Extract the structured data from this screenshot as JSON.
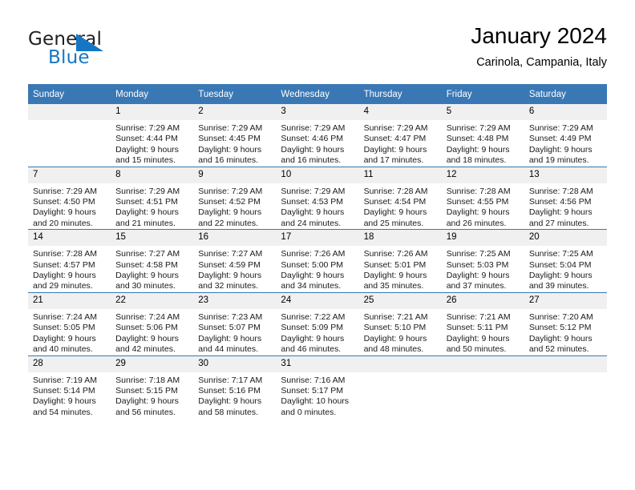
{
  "brand": {
    "name_part1": "General",
    "name_part2": "Blue",
    "logo_icon": "triangle-flag-icon"
  },
  "header": {
    "title": "January 2024",
    "subtitle": "Carinola, Campania, Italy"
  },
  "colors": {
    "header_blue": "#3a78b5",
    "daynum_band": "#f0f0f0",
    "brand_blue": "#1577c4"
  },
  "weekdays": [
    "Sunday",
    "Monday",
    "Tuesday",
    "Wednesday",
    "Thursday",
    "Friday",
    "Saturday"
  ],
  "weeks": [
    [
      {
        "day": "",
        "blank": true,
        "sunrise": "",
        "sunset": "",
        "daylight1": "",
        "daylight2": ""
      },
      {
        "day": "1",
        "sunrise": "Sunrise: 7:29 AM",
        "sunset": "Sunset: 4:44 PM",
        "daylight1": "Daylight: 9 hours",
        "daylight2": "and 15 minutes."
      },
      {
        "day": "2",
        "sunrise": "Sunrise: 7:29 AM",
        "sunset": "Sunset: 4:45 PM",
        "daylight1": "Daylight: 9 hours",
        "daylight2": "and 16 minutes."
      },
      {
        "day": "3",
        "sunrise": "Sunrise: 7:29 AM",
        "sunset": "Sunset: 4:46 PM",
        "daylight1": "Daylight: 9 hours",
        "daylight2": "and 16 minutes."
      },
      {
        "day": "4",
        "sunrise": "Sunrise: 7:29 AM",
        "sunset": "Sunset: 4:47 PM",
        "daylight1": "Daylight: 9 hours",
        "daylight2": "and 17 minutes."
      },
      {
        "day": "5",
        "sunrise": "Sunrise: 7:29 AM",
        "sunset": "Sunset: 4:48 PM",
        "daylight1": "Daylight: 9 hours",
        "daylight2": "and 18 minutes."
      },
      {
        "day": "6",
        "sunrise": "Sunrise: 7:29 AM",
        "sunset": "Sunset: 4:49 PM",
        "daylight1": "Daylight: 9 hours",
        "daylight2": "and 19 minutes."
      }
    ],
    [
      {
        "day": "7",
        "sunrise": "Sunrise: 7:29 AM",
        "sunset": "Sunset: 4:50 PM",
        "daylight1": "Daylight: 9 hours",
        "daylight2": "and 20 minutes."
      },
      {
        "day": "8",
        "sunrise": "Sunrise: 7:29 AM",
        "sunset": "Sunset: 4:51 PM",
        "daylight1": "Daylight: 9 hours",
        "daylight2": "and 21 minutes."
      },
      {
        "day": "9",
        "sunrise": "Sunrise: 7:29 AM",
        "sunset": "Sunset: 4:52 PM",
        "daylight1": "Daylight: 9 hours",
        "daylight2": "and 22 minutes."
      },
      {
        "day": "10",
        "sunrise": "Sunrise: 7:29 AM",
        "sunset": "Sunset: 4:53 PM",
        "daylight1": "Daylight: 9 hours",
        "daylight2": "and 24 minutes."
      },
      {
        "day": "11",
        "sunrise": "Sunrise: 7:28 AM",
        "sunset": "Sunset: 4:54 PM",
        "daylight1": "Daylight: 9 hours",
        "daylight2": "and 25 minutes."
      },
      {
        "day": "12",
        "sunrise": "Sunrise: 7:28 AM",
        "sunset": "Sunset: 4:55 PM",
        "daylight1": "Daylight: 9 hours",
        "daylight2": "and 26 minutes."
      },
      {
        "day": "13",
        "sunrise": "Sunrise: 7:28 AM",
        "sunset": "Sunset: 4:56 PM",
        "daylight1": "Daylight: 9 hours",
        "daylight2": "and 27 minutes."
      }
    ],
    [
      {
        "day": "14",
        "sunrise": "Sunrise: 7:28 AM",
        "sunset": "Sunset: 4:57 PM",
        "daylight1": "Daylight: 9 hours",
        "daylight2": "and 29 minutes."
      },
      {
        "day": "15",
        "sunrise": "Sunrise: 7:27 AM",
        "sunset": "Sunset: 4:58 PM",
        "daylight1": "Daylight: 9 hours",
        "daylight2": "and 30 minutes."
      },
      {
        "day": "16",
        "sunrise": "Sunrise: 7:27 AM",
        "sunset": "Sunset: 4:59 PM",
        "daylight1": "Daylight: 9 hours",
        "daylight2": "and 32 minutes."
      },
      {
        "day": "17",
        "sunrise": "Sunrise: 7:26 AM",
        "sunset": "Sunset: 5:00 PM",
        "daylight1": "Daylight: 9 hours",
        "daylight2": "and 34 minutes."
      },
      {
        "day": "18",
        "sunrise": "Sunrise: 7:26 AM",
        "sunset": "Sunset: 5:01 PM",
        "daylight1": "Daylight: 9 hours",
        "daylight2": "and 35 minutes."
      },
      {
        "day": "19",
        "sunrise": "Sunrise: 7:25 AM",
        "sunset": "Sunset: 5:03 PM",
        "daylight1": "Daylight: 9 hours",
        "daylight2": "and 37 minutes."
      },
      {
        "day": "20",
        "sunrise": "Sunrise: 7:25 AM",
        "sunset": "Sunset: 5:04 PM",
        "daylight1": "Daylight: 9 hours",
        "daylight2": "and 39 minutes."
      }
    ],
    [
      {
        "day": "21",
        "sunrise": "Sunrise: 7:24 AM",
        "sunset": "Sunset: 5:05 PM",
        "daylight1": "Daylight: 9 hours",
        "daylight2": "and 40 minutes."
      },
      {
        "day": "22",
        "sunrise": "Sunrise: 7:24 AM",
        "sunset": "Sunset: 5:06 PM",
        "daylight1": "Daylight: 9 hours",
        "daylight2": "and 42 minutes."
      },
      {
        "day": "23",
        "sunrise": "Sunrise: 7:23 AM",
        "sunset": "Sunset: 5:07 PM",
        "daylight1": "Daylight: 9 hours",
        "daylight2": "and 44 minutes."
      },
      {
        "day": "24",
        "sunrise": "Sunrise: 7:22 AM",
        "sunset": "Sunset: 5:09 PM",
        "daylight1": "Daylight: 9 hours",
        "daylight2": "and 46 minutes."
      },
      {
        "day": "25",
        "sunrise": "Sunrise: 7:21 AM",
        "sunset": "Sunset: 5:10 PM",
        "daylight1": "Daylight: 9 hours",
        "daylight2": "and 48 minutes."
      },
      {
        "day": "26",
        "sunrise": "Sunrise: 7:21 AM",
        "sunset": "Sunset: 5:11 PM",
        "daylight1": "Daylight: 9 hours",
        "daylight2": "and 50 minutes."
      },
      {
        "day": "27",
        "sunrise": "Sunrise: 7:20 AM",
        "sunset": "Sunset: 5:12 PM",
        "daylight1": "Daylight: 9 hours",
        "daylight2": "and 52 minutes."
      }
    ],
    [
      {
        "day": "28",
        "sunrise": "Sunrise: 7:19 AM",
        "sunset": "Sunset: 5:14 PM",
        "daylight1": "Daylight: 9 hours",
        "daylight2": "and 54 minutes."
      },
      {
        "day": "29",
        "sunrise": "Sunrise: 7:18 AM",
        "sunset": "Sunset: 5:15 PM",
        "daylight1": "Daylight: 9 hours",
        "daylight2": "and 56 minutes."
      },
      {
        "day": "30",
        "sunrise": "Sunrise: 7:17 AM",
        "sunset": "Sunset: 5:16 PM",
        "daylight1": "Daylight: 9 hours",
        "daylight2": "and 58 minutes."
      },
      {
        "day": "31",
        "sunrise": "Sunrise: 7:16 AM",
        "sunset": "Sunset: 5:17 PM",
        "daylight1": "Daylight: 10 hours",
        "daylight2": "and 0 minutes."
      },
      {
        "day": "",
        "blank": true,
        "sunrise": "",
        "sunset": "",
        "daylight1": "",
        "daylight2": ""
      },
      {
        "day": "",
        "blank": true,
        "sunrise": "",
        "sunset": "",
        "daylight1": "",
        "daylight2": ""
      },
      {
        "day": "",
        "blank": true,
        "sunrise": "",
        "sunset": "",
        "daylight1": "",
        "daylight2": ""
      }
    ]
  ]
}
